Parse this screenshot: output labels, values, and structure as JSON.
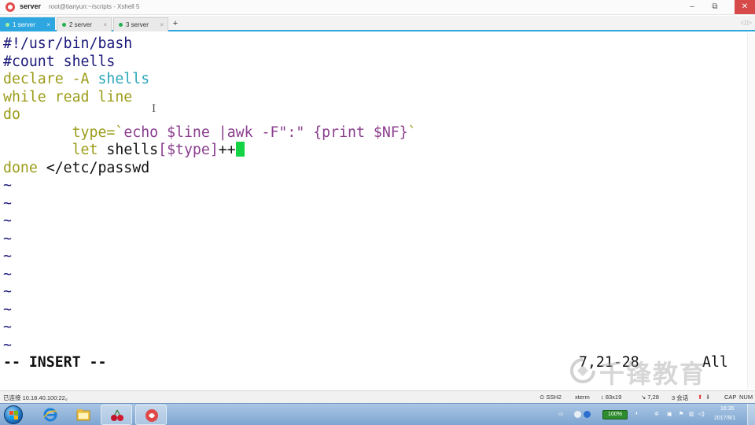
{
  "window": {
    "tab_label": "server",
    "title": "root@tianyun:~/scripts - Xshell 5",
    "controls": {
      "minimize": "–",
      "maximize": "⧉",
      "close": "✕"
    }
  },
  "tabs": [
    {
      "label": "1 server",
      "active": true
    },
    {
      "label": "2 server",
      "active": false
    },
    {
      "label": "3 server",
      "active": false
    }
  ],
  "tab_add_label": "+",
  "tab_nav_label": "◁ ▷",
  "editor": {
    "line1": "#!/usr/bin/bash",
    "line2": "#count shells",
    "line3_kw": "declare -A ",
    "line3_var": "shells",
    "line4": "while read line",
    "line5": "do",
    "line6_indent": "        ",
    "line6_a": "type=`",
    "line6_b": "echo ",
    "line6_c": "$line |",
    "line6_d": "awk -F",
    "line6_e": "\":\" {print $NF}",
    "line6_f": "`",
    "line7_indent": "        ",
    "line7_a": "let ",
    "line7_b": "shells",
    "line7_c": "[$type]",
    "line7_d": "++",
    "line8_a": "done ",
    "line8_b": "</etc/passwd",
    "tilde": "~",
    "mode": "-- INSERT --",
    "position": "7,21-28",
    "scroll": "All"
  },
  "watermark": "千锋教育",
  "status": {
    "connection": "已连接 10.18.40.100:22。",
    "protocol": "SSH2",
    "term": "xterm",
    "size": "83x19",
    "cursor": "7,28",
    "sessions": "3 会话",
    "caps": "CAP",
    "num": "NUM"
  },
  "taskbar": {
    "battery": "100%",
    "time": "16:36",
    "date": "2017/9/1"
  },
  "colors": {
    "comment": "#1b1a7a",
    "keyword": "#9c9c1a",
    "variable": "#2aa6b8",
    "string": "#8a3d8e",
    "cursor": "#14d446",
    "tab_active": "#2ea7e0"
  },
  "icons": [
    "xshell-icon",
    "windows-start-icon",
    "internet-explorer-icon",
    "file-explorer-icon",
    "cherry-icon",
    "xshell-taskbar-icon"
  ]
}
